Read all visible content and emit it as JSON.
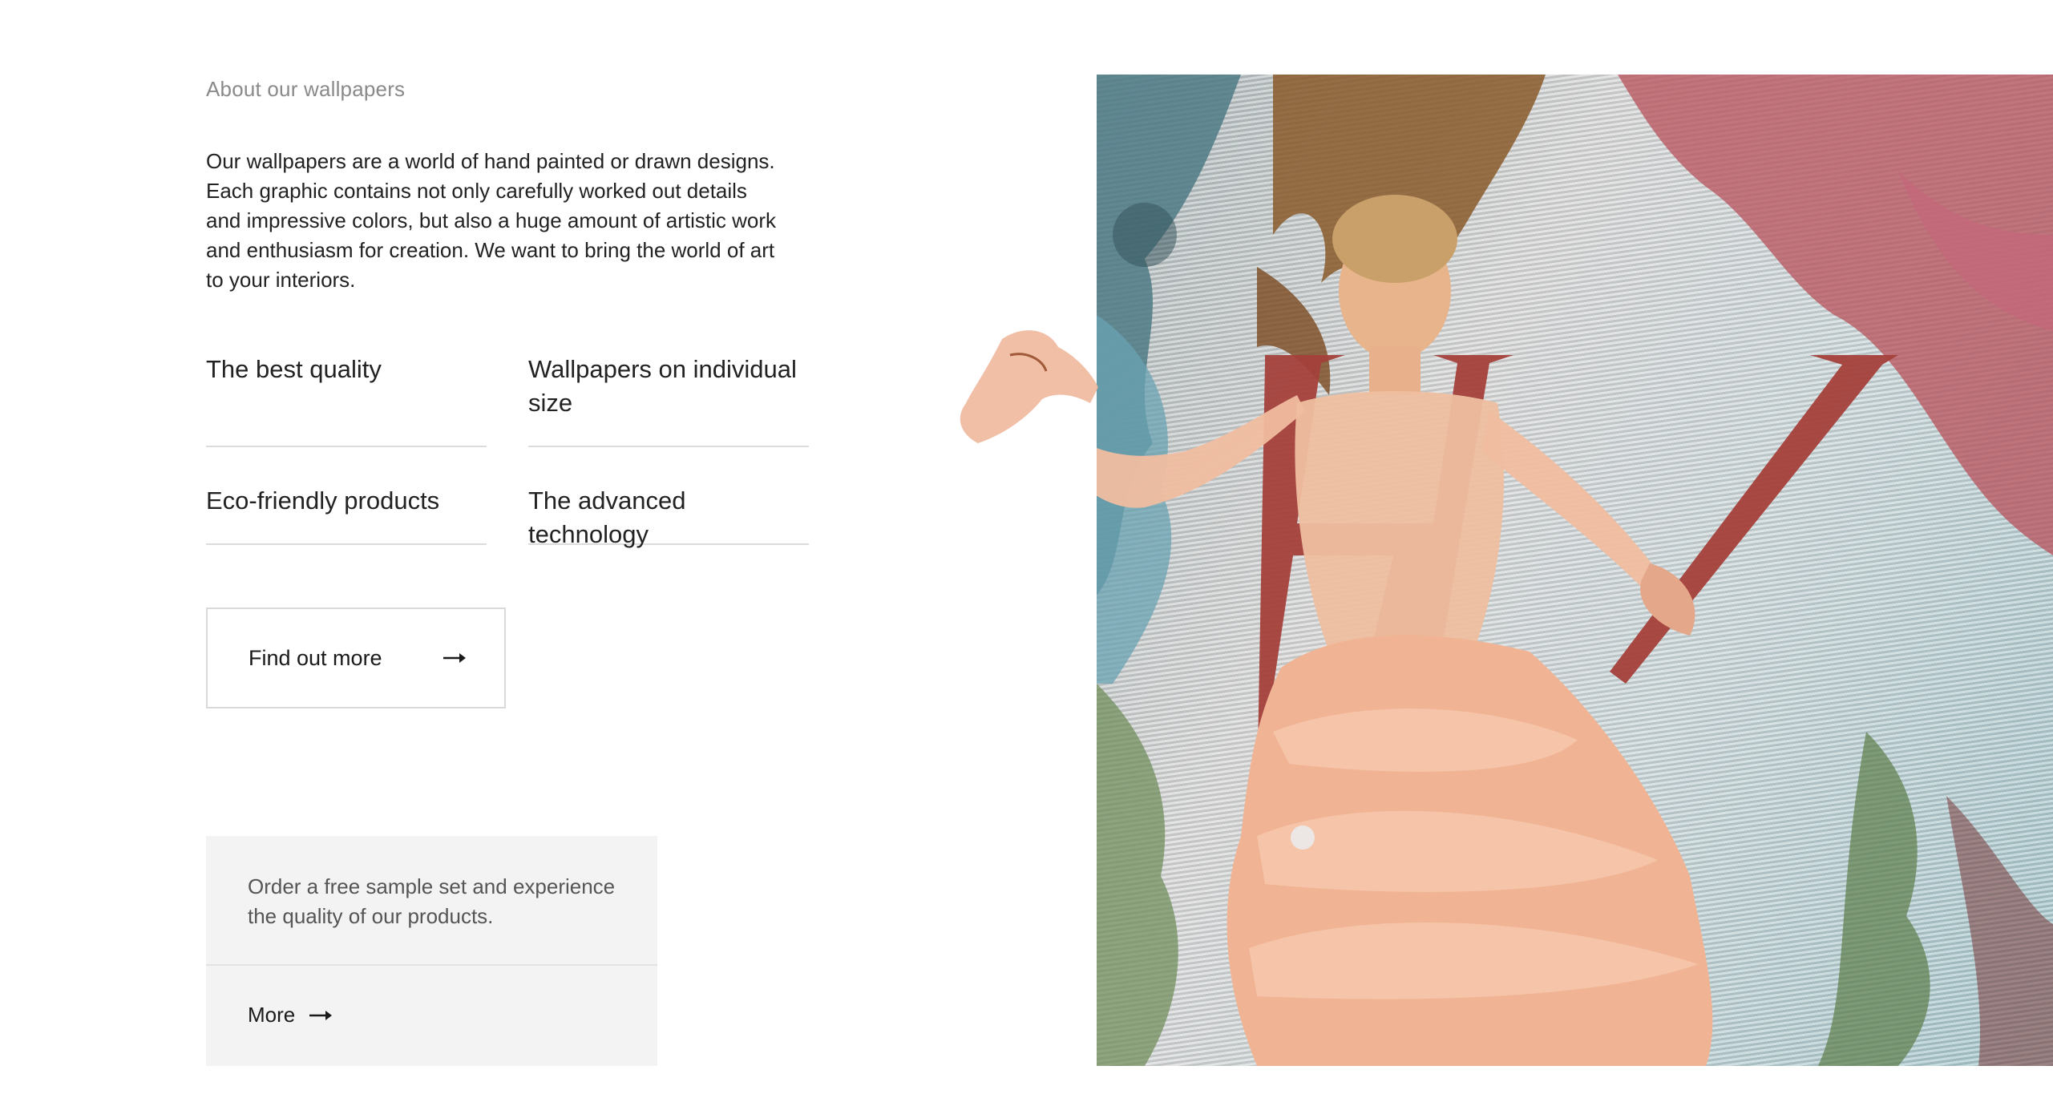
{
  "about": {
    "eyebrow": "About our wallpapers",
    "intro": "Our wallpapers are a world of hand painted or drawn designs. Each graphic contains not only carefully worked out details and impressive colors, but also a huge amount of artistic work and enthusiasm for creation. We want to bring the world of art to your interiors.",
    "features": [
      "The best quality",
      "Wallpapers on individual size",
      "Eco-friendly products",
      "The advanced technology"
    ],
    "cta_label": "Find out more"
  },
  "sample": {
    "text": "Order a free sample set and experience the quality of our products.",
    "more_label": "More"
  },
  "icons": {
    "cta_arrow": "arrow-right-icon",
    "more_arrow": "arrow-right-icon"
  },
  "colors": {
    "letter_red": "#a4403b",
    "dress_peach": "#f0b494",
    "border": "#d9d9d9",
    "sample_bg": "#f3f3f3"
  }
}
